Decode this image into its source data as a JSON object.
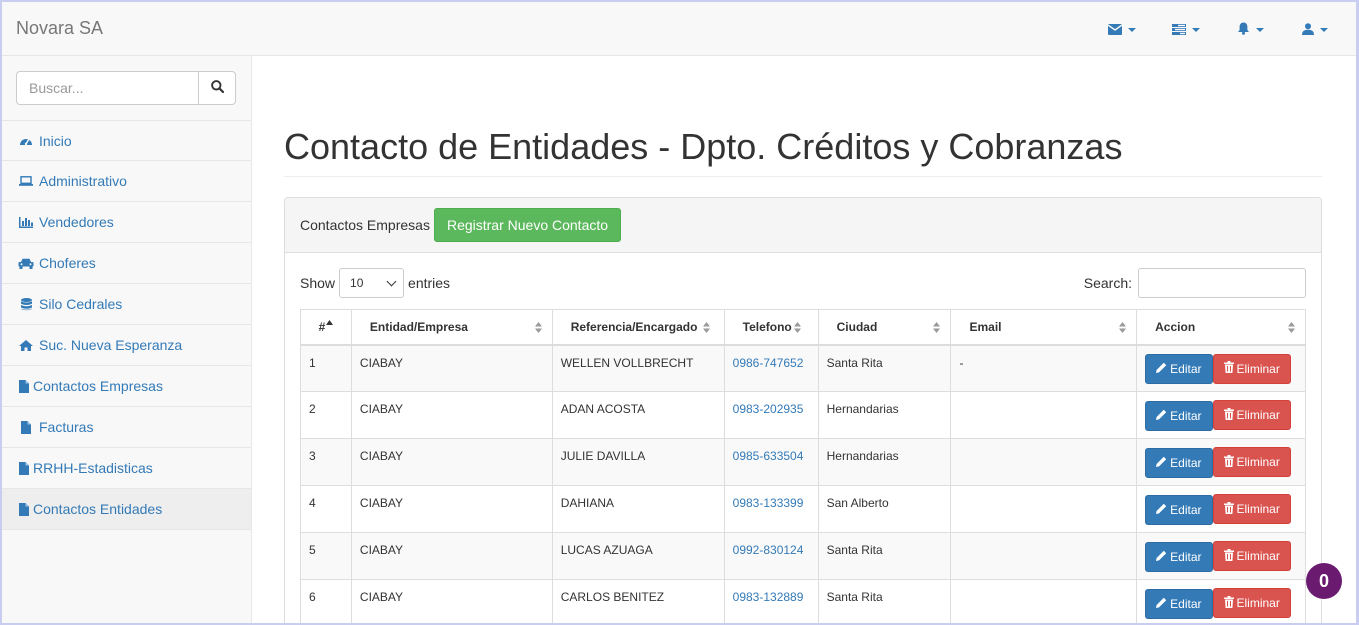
{
  "navbar": {
    "brand": "Novara SA",
    "icons": [
      "envelope-icon",
      "tasks-icon",
      "bell-icon",
      "user-icon"
    ]
  },
  "sidebar": {
    "search_placeholder": "Buscar...",
    "items": [
      {
        "label": "Inicio",
        "icon": "dashboard-icon"
      },
      {
        "label": "Administrativo",
        "icon": "laptop-icon"
      },
      {
        "label": "Vendedores",
        "icon": "bar-chart-icon"
      },
      {
        "label": "Choferes",
        "icon": "car-icon"
      },
      {
        "label": "Silo Cedrales",
        "icon": "database-icon"
      },
      {
        "label": "Suc. Nueva Esperanza",
        "icon": "home-icon"
      },
      {
        "label": "Contactos Empresas",
        "icon": "file-icon"
      },
      {
        "label": "Facturas",
        "icon": "file-icon"
      },
      {
        "label": "RRHH-Estadisticas",
        "icon": "file-icon"
      },
      {
        "label": "Contactos Entidades",
        "icon": "file-icon",
        "active": true
      }
    ]
  },
  "main": {
    "title": "Contacto de Entidades - Dpto. Créditos y Cobranzas",
    "panel_label": "Contactos Empresas",
    "register_button": "Registrar Nuevo Contacto",
    "show_label": "Show",
    "entries_label": "entries",
    "page_length": "10",
    "search_label": "Search:"
  },
  "table": {
    "headers": [
      "#",
      "Entidad/Empresa",
      "Referencia/Encargado",
      "Telefono",
      "Ciudad",
      "Email",
      "Accion"
    ],
    "rows": [
      {
        "num": "1",
        "entidad": "CIABAY",
        "referencia": "WELLEN VOLLBRECHT",
        "telefono": "0986-747652",
        "ciudad": "Santa Rita",
        "email": "-"
      },
      {
        "num": "2",
        "entidad": "CIABAY",
        "referencia": "ADAN ACOSTA",
        "telefono": "0983-202935",
        "ciudad": "Hernandarias",
        "email": ""
      },
      {
        "num": "3",
        "entidad": "CIABAY",
        "referencia": "JULIE DAVILLA",
        "telefono": "0985-633504",
        "ciudad": "Hernandarias",
        "email": ""
      },
      {
        "num": "4",
        "entidad": "CIABAY",
        "referencia": "DAHIANA",
        "telefono": "0983-133399",
        "ciudad": "San Alberto",
        "email": ""
      },
      {
        "num": "5",
        "entidad": "CIABAY",
        "referencia": "LUCAS AZUAGA",
        "telefono": "0992-830124",
        "ciudad": "Santa Rita",
        "email": ""
      },
      {
        "num": "6",
        "entidad": "CIABAY",
        "referencia": "CARLOS BENITEZ",
        "telefono": "0983-132889",
        "ciudad": "Santa Rita",
        "email": ""
      }
    ],
    "edit_label": "Editar",
    "delete_label": "Eliminar"
  },
  "floating_badge": "0",
  "colors": {
    "link": "#337ab7",
    "success": "#5cb85c",
    "danger": "#d9534f",
    "badge": "#6a1a6f"
  }
}
